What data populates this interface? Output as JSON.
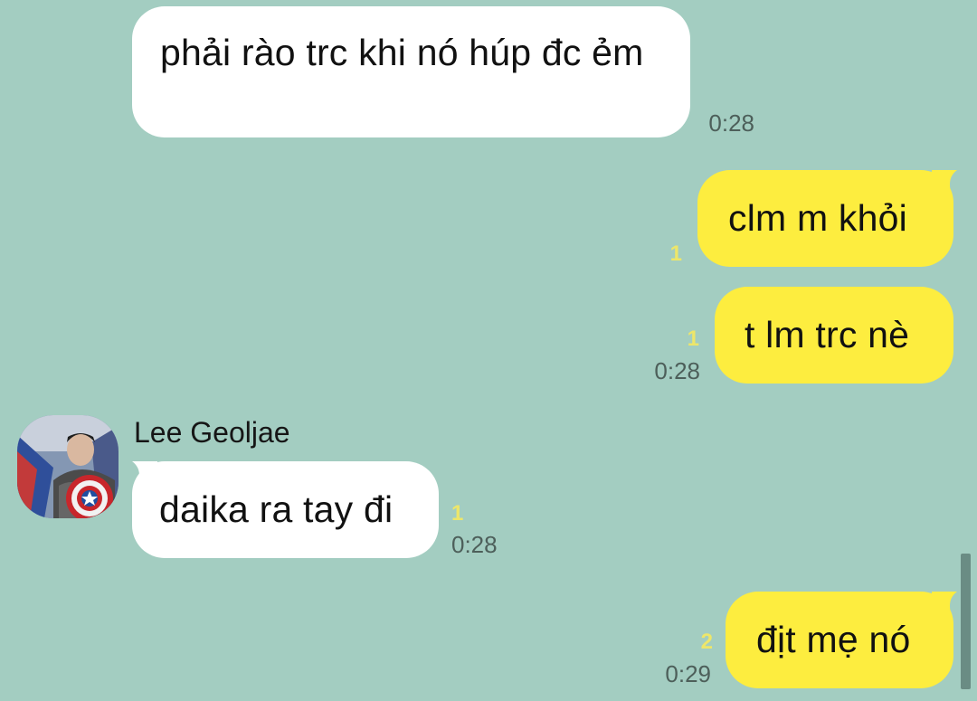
{
  "messages": [
    {
      "direction": "in",
      "text": "phải rào trc khi nó húp đc ẻm",
      "time": "0:28"
    },
    {
      "direction": "out",
      "text": "clm m khỏi",
      "unread": "1"
    },
    {
      "direction": "out",
      "text": "t lm trc nè",
      "unread": "1",
      "time": "0:28"
    },
    {
      "direction": "in",
      "sender": "Lee Geoljae",
      "text": "daika ra tay đi",
      "unread": "1",
      "time": "0:28"
    },
    {
      "direction": "out",
      "text": "địt mẹ nó",
      "unread": "2",
      "time": "0:29"
    }
  ],
  "colors": {
    "background": "#a3cdc1",
    "incoming_bubble": "#ffffff",
    "outgoing_bubble": "#fded3f",
    "unread_count": "#ede66a",
    "timestamp": "#4d5f5a"
  },
  "icons": {
    "avatar": "profile-photo"
  }
}
